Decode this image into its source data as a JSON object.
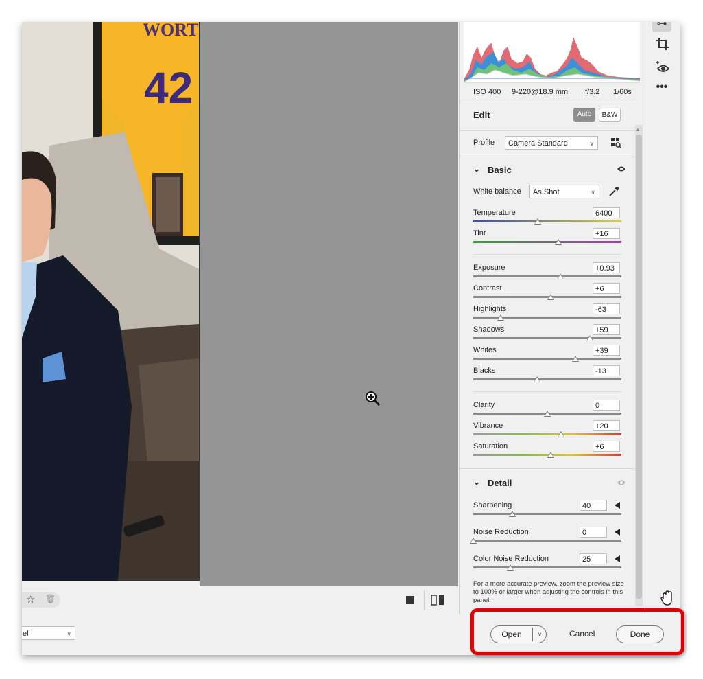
{
  "exif": {
    "iso": "ISO 400",
    "lens": "9-220@18.9 mm",
    "aperture": "f/3.2",
    "shutter": "1/60s"
  },
  "edit": {
    "title": "Edit",
    "auto_label": "Auto",
    "bw_label": "B&W"
  },
  "profile": {
    "label": "Profile",
    "value": "Camera Standard"
  },
  "basic": {
    "title": "Basic",
    "white_balance_label": "White balance",
    "white_balance_value": "As Shot",
    "sliders": [
      {
        "label": "Temperature",
        "value": "6400"
      },
      {
        "label": "Tint",
        "value": "+16"
      },
      {
        "label": "Exposure",
        "value": "+0.93"
      },
      {
        "label": "Contrast",
        "value": "+6"
      },
      {
        "label": "Highlights",
        "value": "-63"
      },
      {
        "label": "Shadows",
        "value": "+59"
      },
      {
        "label": "Whites",
        "value": "+39"
      },
      {
        "label": "Blacks",
        "value": "-13"
      },
      {
        "label": "Clarity",
        "value": "0"
      },
      {
        "label": "Vibrance",
        "value": "+20"
      },
      {
        "label": "Saturation",
        "value": "+6"
      }
    ]
  },
  "detail": {
    "title": "Detail",
    "sliders": [
      {
        "label": "Sharpening",
        "value": "40"
      },
      {
        "label": "Noise Reduction",
        "value": "0"
      },
      {
        "label": "Color Noise Reduction",
        "value": "25"
      }
    ],
    "note": "For a more accurate preview, zoom the preview size to 100% or larger when adjusting the controls in this panel."
  },
  "photo": {
    "jersey_name": "WORTHY",
    "jersey_number": "42"
  },
  "footer": {
    "dropdown_value": "el",
    "open_label": "Open",
    "cancel_label": "Cancel",
    "done_label": "Done"
  },
  "colors": {
    "highlight": "#e40000",
    "panel_bg": "#f0f0f0",
    "canvas_gray": "#959595"
  }
}
